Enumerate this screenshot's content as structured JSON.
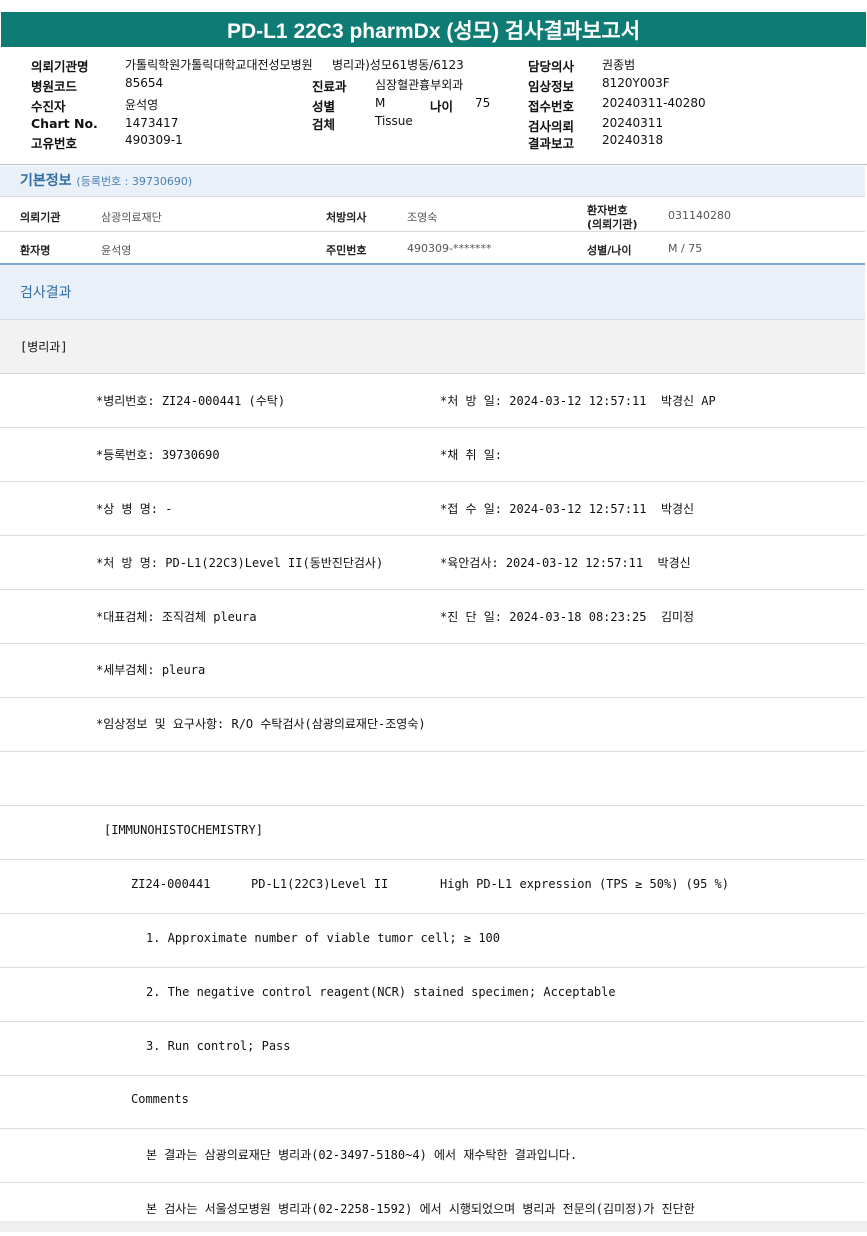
{
  "report_title": "PD-L1 22C3 pharmDx (성모) 검사결과보고서",
  "header": {
    "institution": {
      "label": "의뢰기관명",
      "value": "가톨릭학원가톨릭대학교대전성모병원"
    },
    "ward": {
      "label": "병동",
      "value": "병리과)성모61병동/6123"
    },
    "doctor": {
      "label": "담당의사",
      "value": "권종범"
    },
    "hospital_code": {
      "label": "병원코드",
      "value": "85654"
    },
    "department": {
      "label": "진료과",
      "value": "심장혈관흉부외과"
    },
    "clinical_info": {
      "label": "임상정보",
      "value": "8120Y003F"
    },
    "patient": {
      "label": "수진자",
      "value": "윤석영"
    },
    "sex": {
      "label": "성별",
      "value": "M"
    },
    "age": {
      "label": "나이",
      "value": "75"
    },
    "receipt_no": {
      "label": "접수번호",
      "value": "20240311-40280"
    },
    "chart_no": {
      "label": "Chart No.",
      "value": "1473417"
    },
    "specimen": {
      "label": "검체",
      "value": "Tissue"
    },
    "request_date": {
      "label": "검사의뢰",
      "value": "20240311"
    },
    "unique_no": {
      "label": "고유번호",
      "value": "490309-1"
    },
    "report_date": {
      "label": "결과보고",
      "value": "20240318"
    }
  },
  "basic_info": {
    "title": "기본정보",
    "reg": "(등록번호 : 39730690)",
    "requesting_institution": {
      "label": "의뢰기관",
      "value": "삼광의료재단"
    },
    "prescriber": {
      "label": "처방의사",
      "value": "조영숙"
    },
    "patient_no": {
      "label1": "환자번호",
      "label2": "(의뢰기관)",
      "value": "031140280"
    },
    "patient_name": {
      "label": "환자명",
      "value": "윤석영"
    },
    "resident_no": {
      "label": "주민번호",
      "value": "490309-*******"
    },
    "sex_age": {
      "label": "성별/나이",
      "value": "M / 75"
    }
  },
  "results": {
    "title": "검사결과",
    "section": "[병리과]",
    "lines": [
      {
        "left": "*병리번호: ZI24-000441 (수탁)",
        "right": "*처 방 일: 2024-03-12 12:57:11  박경신 AP"
      },
      {
        "left": "*등록번호: 39730690",
        "right": "*채 취 일:"
      },
      {
        "left": "*상 병 명: -",
        "right": "*접 수 일: 2024-03-12 12:57:11  박경신"
      },
      {
        "left": "*처 방 명: PD-L1(22C3)Level II(동반진단검사)",
        "right": "*육안검사: 2024-03-12 12:57:11  박경신"
      },
      {
        "left": "*대표검체: 조직검체 pleura",
        "right": "*진 단 일: 2024-03-18 08:23:25  김미정"
      },
      {
        "left": "*세부검체: pleura",
        "right": ""
      },
      {
        "left": "*임상정보 및 요구사항: R/O 수탁검사(삼광의료재단-조영숙)",
        "right": ""
      }
    ],
    "ihc_header": "[IMMUNOHISTOCHEMISTRY]",
    "ihc_id": "ZI24-000441",
    "ihc_test": "PD-L1(22C3)Level II",
    "ihc_result": "High PD-L1 expression (TPS ≥ 50%) (95 %)",
    "items": [
      "1. Approximate number of viable tumor cell; ≥ 100",
      "2. The negative control reagent(NCR) stained specimen; Acceptable",
      "3. Run control; Pass"
    ],
    "comments_label": "Comments",
    "comments": [
      "본 결과는 삼광의료재단 병리과(02-3497-5180~4) 에서 재수탁한 결과입니다.",
      "본 검사는 서울성모병원 병리과(02-2258-1592) 에서 시행되었으며 병리과 전문의(김미정)가 진단한"
    ]
  }
}
